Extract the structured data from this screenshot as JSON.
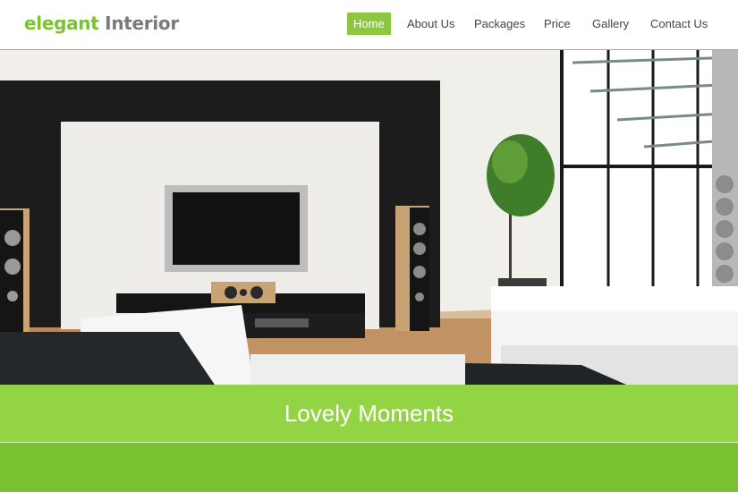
{
  "logo": {
    "part1": "elegant",
    "part2": "Interior"
  },
  "nav": [
    {
      "label": "Home",
      "active": true
    },
    {
      "label": "About Us",
      "active": false
    },
    {
      "label": "Packages",
      "active": false
    },
    {
      "label": "Price",
      "active": false
    },
    {
      "label": "Gallery",
      "active": false
    },
    {
      "label": "Contact Us",
      "active": false
    }
  ],
  "hero": {
    "title": "Lovely Moments"
  },
  "colors": {
    "accent": "#8dc63f",
    "band": "#93d445",
    "lower": "#7ac231"
  }
}
